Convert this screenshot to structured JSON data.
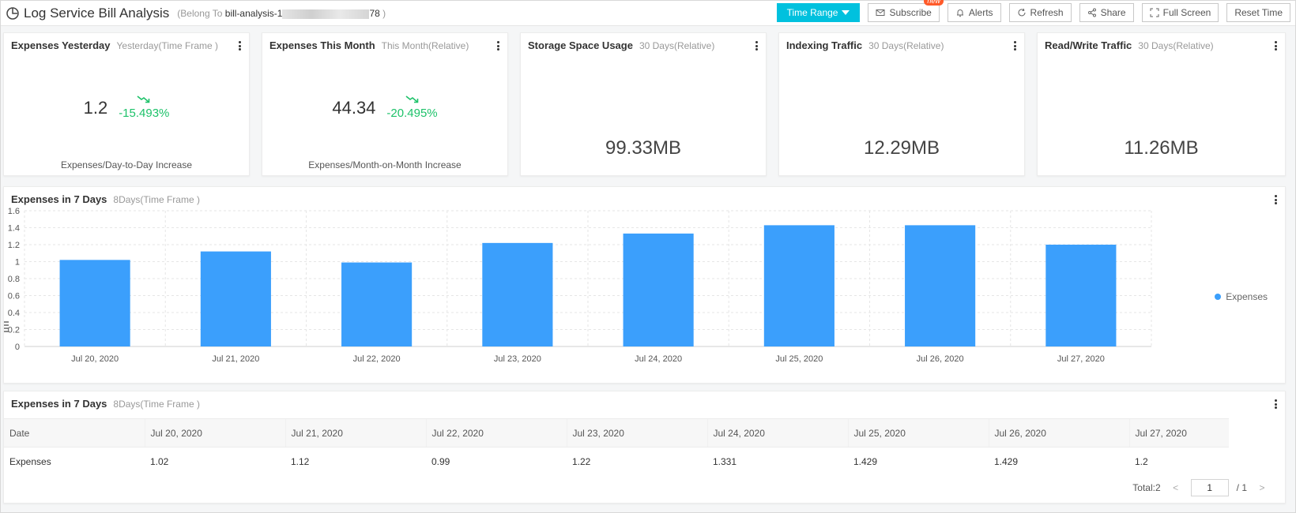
{
  "header": {
    "title": "Log Service Bill Analysis",
    "belong_prefix": "(Belong To",
    "project_start": "bill-analysis-1",
    "project_end": "78",
    "belong_suffix": ")"
  },
  "toolbar": {
    "time_range": "Time Range",
    "subscribe": "Subscribe",
    "new_badge": "new",
    "alerts": "Alerts",
    "refresh": "Refresh",
    "share": "Share",
    "full_screen": "Full Screen",
    "reset_time": "Reset Time"
  },
  "cards": {
    "yesterday": {
      "title": "Expenses Yesterday",
      "sub": "Yesterday(Time Frame )",
      "value": "1.2",
      "change": "-15.493%",
      "desc": "Expenses/Day-to-Day Increase"
    },
    "month": {
      "title": "Expenses This Month",
      "sub": "This Month(Relative)",
      "value": "44.34",
      "change": "-20.495%",
      "desc": "Expenses/Month-on-Month Increase"
    },
    "storage": {
      "title": "Storage Space Usage",
      "sub": "30 Days(Relative)",
      "value": "99.33MB"
    },
    "indexing": {
      "title": "Indexing Traffic",
      "sub": "30 Days(Relative)",
      "value": "12.29MB"
    },
    "readwrite": {
      "title": "Read/Write Traffic",
      "sub": "30 Days(Relative)",
      "value": "11.26MB"
    }
  },
  "chart_panel": {
    "title": "Expenses in 7 Days",
    "sub": "8Days(Time Frame )"
  },
  "chart_data": {
    "type": "bar",
    "categories": [
      "Jul 20, 2020",
      "Jul 21, 2020",
      "Jul 22, 2020",
      "Jul 23, 2020",
      "Jul 24, 2020",
      "Jul 25, 2020",
      "Jul 26, 2020",
      "Jul 27, 2020"
    ],
    "series": [
      {
        "name": "Expenses",
        "values": [
          1.02,
          1.12,
          0.99,
          1.22,
          1.331,
          1.429,
          1.429,
          1.2
        ]
      }
    ],
    "yticks": [
      "0",
      "0.2",
      "0.4",
      "0.6",
      "0.8",
      "1",
      "1.2",
      "1.4",
      "1.6"
    ],
    "ylim": [
      0,
      1.6
    ],
    "grid": true,
    "legend_position": "right",
    "bar_color": "#3b9ffc"
  },
  "table_panel": {
    "title": "Expenses in 7 Days",
    "sub": "8Days(Time Frame )",
    "headers": [
      "Date",
      "Jul 20, 2020",
      "Jul 21, 2020",
      "Jul 22, 2020",
      "Jul 23, 2020",
      "Jul 24, 2020",
      "Jul 25, 2020",
      "Jul 26, 2020",
      "Jul 27, 2020"
    ],
    "row": [
      "Expenses",
      "1.02",
      "1.12",
      "0.99",
      "1.22",
      "1.331",
      "1.429",
      "1.429",
      "1.2"
    ],
    "total": "Total:2",
    "page": "1",
    "pages": "/ 1",
    "prev": "<",
    "next": ">"
  },
  "colors": {
    "accent": "#00c1de",
    "positive": "#1ec26a",
    "bar": "#3b9ffc"
  }
}
